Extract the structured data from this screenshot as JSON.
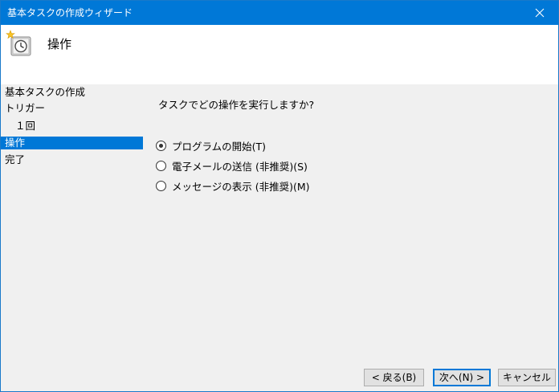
{
  "window": {
    "title": "基本タスクの作成ウィザード",
    "close_glyph": "✕"
  },
  "header": {
    "title": "操作",
    "icon": "scheduled-task-clock-icon"
  },
  "sidebar": {
    "steps": [
      {
        "label": "基本タスクの作成",
        "active": false
      },
      {
        "label": "トリガー",
        "active": false
      },
      {
        "label": "１回",
        "active": false
      },
      {
        "label": "操作",
        "active": true
      },
      {
        "label": "完了",
        "active": false
      }
    ]
  },
  "content": {
    "question": "タスクでどの操作を実行しますか?",
    "options": [
      {
        "label": "プログラムの開始(T)",
        "checked": true
      },
      {
        "label": "電子メールの送信 (非推奨)(S)",
        "checked": false
      },
      {
        "label": "メッセージの表示 (非推奨)(M)",
        "checked": false
      }
    ]
  },
  "buttons": {
    "back": "< 戻る(B)",
    "next": "次へ(N) >",
    "cancel": "キャンセル"
  },
  "colors": {
    "accent": "#0078d7",
    "background": "#f0f0f0"
  }
}
